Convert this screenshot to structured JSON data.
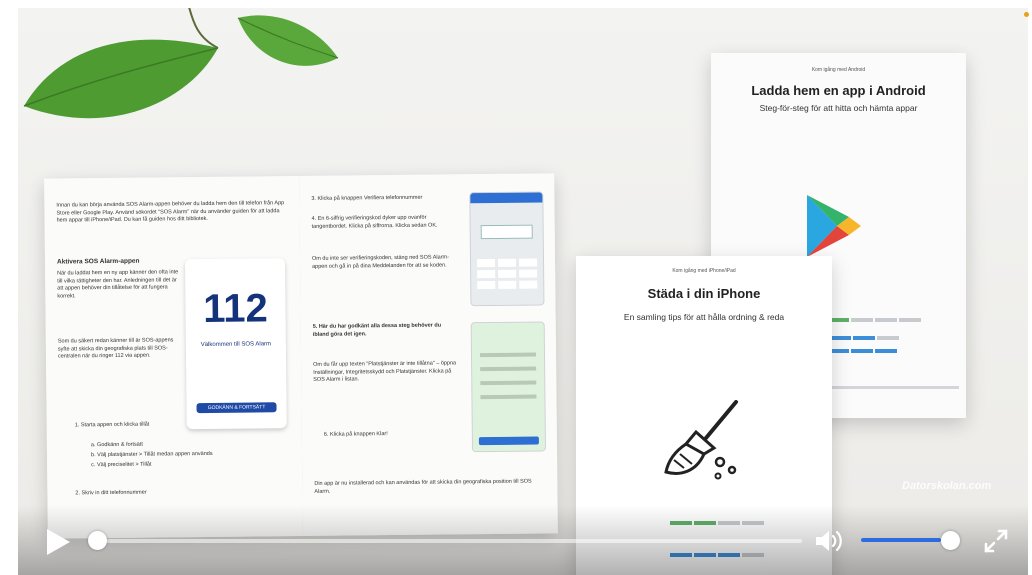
{
  "video": {
    "open_book": {
      "left_page": {
        "intro": "Innan du kan börja använda SOS Alarm-appen behöver du ladda hem den till telefon från App Store eller Google Play. Använd sökordet \"SOS Alarm\" när du använder guiden för att ladda hem appar till iPhone/iPad. Du kan få guiden hos ditt bibliotek.",
        "heading": "Aktivera SOS Alarm-appen",
        "body": "När du laddat hem en ny app känner den ofta inte till vilka rättigheter den har. Anledningen till det är att appen behöver din tillåtelse för att fungera korrekt.",
        "body2": "Som du säkert redan känner till är SOS-appens syfte att skicka din geografiska plats till SOS-centralen när du ringer 112 via appen.",
        "steps": [
          "1. Starta appen och klicka tillåt",
          "a. Godkänn & fortsätt",
          "b. Välj platstjänster > Tillåt medan appen används",
          "c. Välj preciselitet > Tillåt",
          "2. Skriv in ditt telefonnummer"
        ],
        "card_number": "112",
        "card_title": "Välkommen till SOS Alarm",
        "card_button": "GODKÄNN & FORTSÄTT"
      },
      "right_page": {
        "step3": "3. Klicka på knappen Verifiera telefonnummer",
        "step4": "4. En 6-siffrig verifieringskod dyker upp ovanför tangentbordet. Klicka på siffrorna. Klicka sedan OK.",
        "note": "Om du inte ser verifieringskoden, stäng ned SOS Alarm-appen och gå in på dina Meddelanden för att se koden.",
        "step5": "5. Här du har godkänt alla dessa steg behöver du ibland göra det igen.",
        "body": "Om du får upp texten \"Platstjänster är inte tillåtna\" – öppna Inställningar, Integritetsskydd och Platstjänster. Klicka på SOS Alarm i listan.",
        "step6": "6. Klicka på knappen Klar!",
        "footer": "Din app är nu installerad och kan användas för att skicka din geografiska position till SOS Alarm."
      }
    },
    "android_booklet": {
      "kicker": "Kom igång med Android",
      "title": "Ladda hem en app i Android",
      "subtitle": "Steg-för-steg för att hitta och hämta appar"
    },
    "iphone_booklet": {
      "kicker": "Kom igång med iPhone/iPad",
      "title": "Städa i din iPhone",
      "subtitle": "En samling tips för att hålla ordning & reda"
    },
    "watermark": "Datorskolan.com"
  },
  "controls": {
    "progress_fraction": 0.0,
    "volume_fraction": 0.91,
    "icons": {
      "play": "play-icon",
      "volume": "volume-icon",
      "fullscreen": "fullscreen-icon"
    },
    "colors": {
      "volume_fill": "#2c6cdf",
      "knob": "#ffffff",
      "track": "rgba(255,255,255,0.55)"
    }
  }
}
